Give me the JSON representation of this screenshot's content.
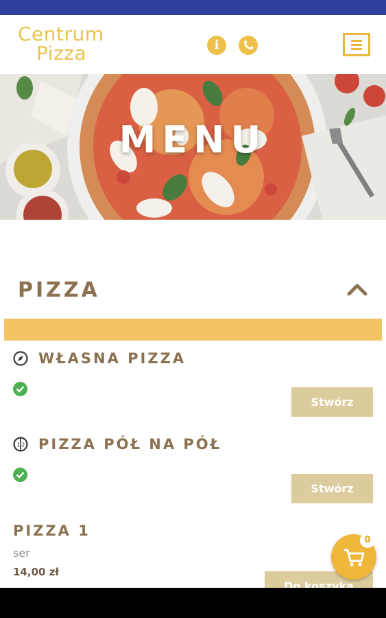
{
  "header": {
    "logo_line1": "Centrum",
    "logo_line2": "Pizza",
    "info_icon": "info-icon",
    "phone_icon": "phone-icon",
    "menu_icon": "hamburger-icon"
  },
  "hero": {
    "title": "MENU"
  },
  "section": {
    "title": "PIZZA",
    "toggle_icon": "chevron-up-icon"
  },
  "items": [
    {
      "title": "WŁASNA PIZZA",
      "icon": "compass-icon",
      "status_icon": "check-icon",
      "button": "Stwórz"
    },
    {
      "title": "PIZZA PÓŁ NA PÓŁ",
      "icon": "half-half-icon",
      "status_icon": "check-icon",
      "button": "Stwórz"
    },
    {
      "title": "PIZZA 1",
      "description": "ser",
      "price": "14,00 zł",
      "button": "Do koszyka"
    }
  ],
  "cart": {
    "count": "0",
    "icon": "cart-icon"
  },
  "colors": {
    "brand_gold": "#e9b73b",
    "title_brown": "#8b7150",
    "accent_bar": "#f2c464",
    "button_bg": "#dccb9c",
    "check_green": "#4caf50",
    "status_bar": "#2f3f9e"
  }
}
